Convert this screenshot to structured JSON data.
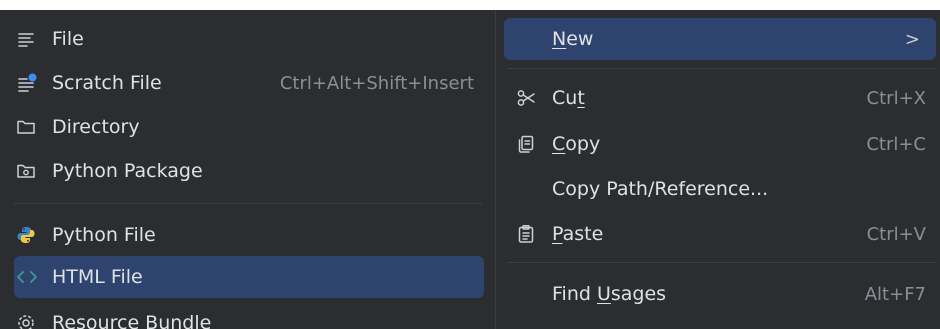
{
  "submenu": {
    "items": [
      {
        "label": "File",
        "icon": "text-file-icon"
      },
      {
        "label": "Scratch File",
        "icon": "scratch-file-icon",
        "shortcut": "Ctrl+Alt+Shift+Insert"
      },
      {
        "label": "Directory",
        "icon": "folder-icon"
      },
      {
        "label": "Python Package",
        "icon": "package-folder-icon"
      },
      {
        "label": "Python File",
        "icon": "python-icon"
      },
      {
        "label": "HTML File",
        "icon": "html-icon"
      },
      {
        "label": "Resource Bundle",
        "icon": "resource-bundle-icon"
      }
    ]
  },
  "context_menu": {
    "items": [
      {
        "pre": "",
        "mnemonic": "N",
        "post": "ew",
        "chevron": ">"
      },
      {
        "pre": "Cu",
        "mnemonic": "t",
        "post": "",
        "shortcut": "Ctrl+X",
        "icon": "scissors-icon"
      },
      {
        "pre": "",
        "mnemonic": "C",
        "post": "opy",
        "shortcut": "Ctrl+C",
        "icon": "copy-icon"
      },
      {
        "label": "Copy Path/Reference..."
      },
      {
        "pre": "",
        "mnemonic": "P",
        "post": "aste",
        "shortcut": "Ctrl+V",
        "icon": "clipboard-icon"
      },
      {
        "pre": "Find ",
        "mnemonic": "U",
        "post": "sages",
        "shortcut": "Alt+F7"
      }
    ]
  },
  "colors": {
    "menu_bg": "#2b2d30",
    "selection": "#2e436e",
    "text": "#dfe1e5",
    "shortcut_text": "#8b8e94",
    "html_icon": "#3d9c8f",
    "scratch_badge": "#3d8bf5"
  }
}
